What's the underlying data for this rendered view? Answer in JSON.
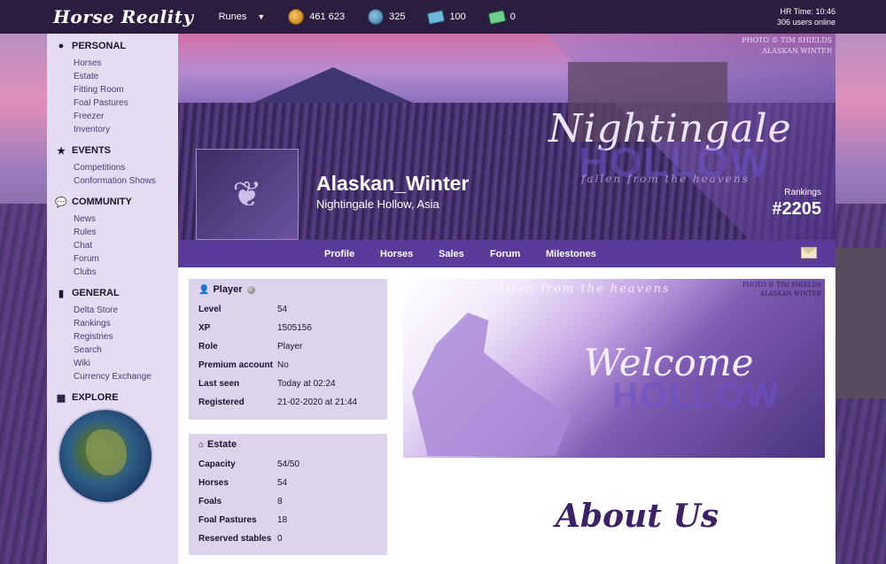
{
  "topbar": {
    "logo": "Horse Reality",
    "runes_label": "Runes",
    "currencies": [
      {
        "icon": "gold-coin-icon",
        "value": "461 623"
      },
      {
        "icon": "wp-coin-icon",
        "value": "325"
      },
      {
        "icon": "blue-ticket-icon",
        "value": "100"
      },
      {
        "icon": "green-ticket-icon",
        "value": "0"
      }
    ],
    "hr_time": "HR Time: 10:46",
    "users_online": "306 users online"
  },
  "sidebar": {
    "sections": [
      {
        "title": "PERSONAL",
        "icon": "user-circle-icon",
        "items": [
          "Horses",
          "Estate",
          "Fitting Room",
          "Foal Pastures",
          "Freezer",
          "Inventory"
        ]
      },
      {
        "title": "EVENTS",
        "icon": "star-icon",
        "items": [
          "Competitions",
          "Conformation Shows"
        ]
      },
      {
        "title": "COMMUNITY",
        "icon": "chat-bubbles-icon",
        "items": [
          "News",
          "Rules",
          "Chat",
          "Forum",
          "Clubs"
        ]
      },
      {
        "title": "GENERAL",
        "icon": "bookmark-icon",
        "items": [
          "Delta Store",
          "Rankings",
          "Registries",
          "Search",
          "Wiki",
          "Currency Exchange"
        ]
      },
      {
        "title": "EXPLORE",
        "icon": "map-icon",
        "items": []
      }
    ]
  },
  "banner": {
    "photo_credit_1": "PHOTO © TIM SHIELDS",
    "photo_credit_2": "ALASKAN WINTER",
    "script_title": "Nightingale",
    "ghost_text": "HOLLOW",
    "tagline": "fallen from the heavens",
    "username": "Alaskan_Winter",
    "subtitle": "Nightingale Hollow, Asia",
    "rankings_label": "Rankings",
    "rankings_value": "#2205"
  },
  "nav": {
    "profile": "Profile",
    "horses": "Horses",
    "sales": "Sales",
    "forum": "Forum",
    "milestones": "Milestones"
  },
  "player": {
    "title": "Player",
    "rows": [
      {
        "k": "Level",
        "v": "54"
      },
      {
        "k": "XP",
        "v": "1505156"
      },
      {
        "k": "Role",
        "v": "Player"
      },
      {
        "k": "Premium account",
        "v": "No"
      },
      {
        "k": "Last seen",
        "v": "Today at 02:24"
      },
      {
        "k": "Registered",
        "v": "21-02-2020 at 21:44"
      }
    ]
  },
  "estate": {
    "title": "Estate",
    "rows": [
      {
        "k": "Capacity",
        "v": "54/50"
      },
      {
        "k": "Horses",
        "v": "54"
      },
      {
        "k": "Foals",
        "v": "8"
      },
      {
        "k": "Foal Pastures",
        "v": "18"
      },
      {
        "k": "Reserved stables",
        "v": "0"
      }
    ]
  },
  "welcome": {
    "tagline": "fallen from the heavens",
    "title": "Welcome",
    "ghost_text": "HOLLOW",
    "photo_credit_1": "PHOTO © TIM SHIELDS",
    "photo_credit_2": "ALASKAN WINTER"
  },
  "about_title": "About Us"
}
